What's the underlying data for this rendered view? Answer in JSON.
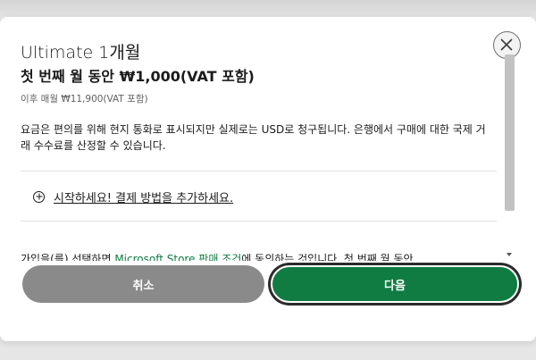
{
  "dialog": {
    "plan_name": "Ultimate 1개월",
    "price_line": "첫 번째 월 동안 ₩1,000(VAT 포함)",
    "after_line": "이후 매월 ₩11,900(VAT 포함)",
    "notice": "요금은 편의를 위해 현지 통화로 표시되지만 실제로는 USD로 청구됩니다. 은행에서 구매에 대한 국제 거래 수수료를 산정할 수 있습니다.",
    "add_payment_label": "시작하세요! 결제 방법을 추가하세요.",
    "terms": {
      "prefix": "가입을(를) 선택하면 ",
      "store_link": "Microsoft Store 판매",
      "space": " ",
      "conditions_link": "조건",
      "suffix": "에 동의하는 것입니다. 첫 번째 월 동안"
    }
  },
  "footer": {
    "cancel_label": "취소",
    "next_label": "다음"
  },
  "colors": {
    "accent_green": "#107c41",
    "cancel_gray": "#8a8a8a"
  },
  "icons": {
    "close": "close-icon",
    "add": "plus-circle-icon",
    "scroll_down": "chevron-down-icon"
  }
}
